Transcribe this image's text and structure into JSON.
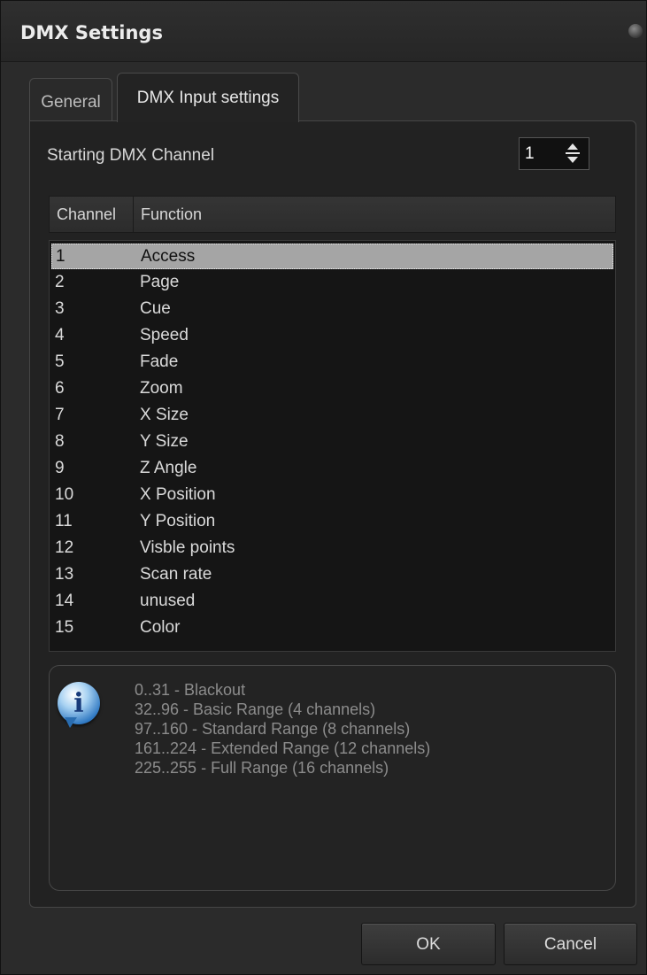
{
  "window": {
    "title": "DMX Settings"
  },
  "tabs": [
    {
      "label": "General",
      "active": false
    },
    {
      "label": "DMX Input settings",
      "active": true
    }
  ],
  "starting_channel": {
    "label": "Starting DMX Channel",
    "value": "1"
  },
  "table": {
    "columns": [
      "Channel",
      "Function"
    ],
    "selected_index": 0,
    "rows": [
      {
        "channel": "1",
        "function": "Access"
      },
      {
        "channel": "2",
        "function": "Page"
      },
      {
        "channel": "3",
        "function": "Cue"
      },
      {
        "channel": "4",
        "function": "Speed"
      },
      {
        "channel": "5",
        "function": "Fade"
      },
      {
        "channel": "6",
        "function": "Zoom"
      },
      {
        "channel": "7",
        "function": "X Size"
      },
      {
        "channel": "8",
        "function": "Y Size"
      },
      {
        "channel": "9",
        "function": "Z Angle"
      },
      {
        "channel": "10",
        "function": "X Position"
      },
      {
        "channel": "11",
        "function": "Y Position"
      },
      {
        "channel": "12",
        "function": "Visble points"
      },
      {
        "channel": "13",
        "function": "Scan rate"
      },
      {
        "channel": "14",
        "function": "unused"
      },
      {
        "channel": "15",
        "function": "Color"
      }
    ]
  },
  "info": {
    "icon": "info-icon",
    "lines": [
      "0..31 - Blackout",
      "32..96 - Basic Range (4 channels)",
      "97..160 - Standard Range (8 channels)",
      "161..224 - Extended Range (12 channels)",
      "225..255 - Full Range (16 channels)"
    ]
  },
  "buttons": {
    "ok": "OK",
    "cancel": "Cancel"
  }
}
